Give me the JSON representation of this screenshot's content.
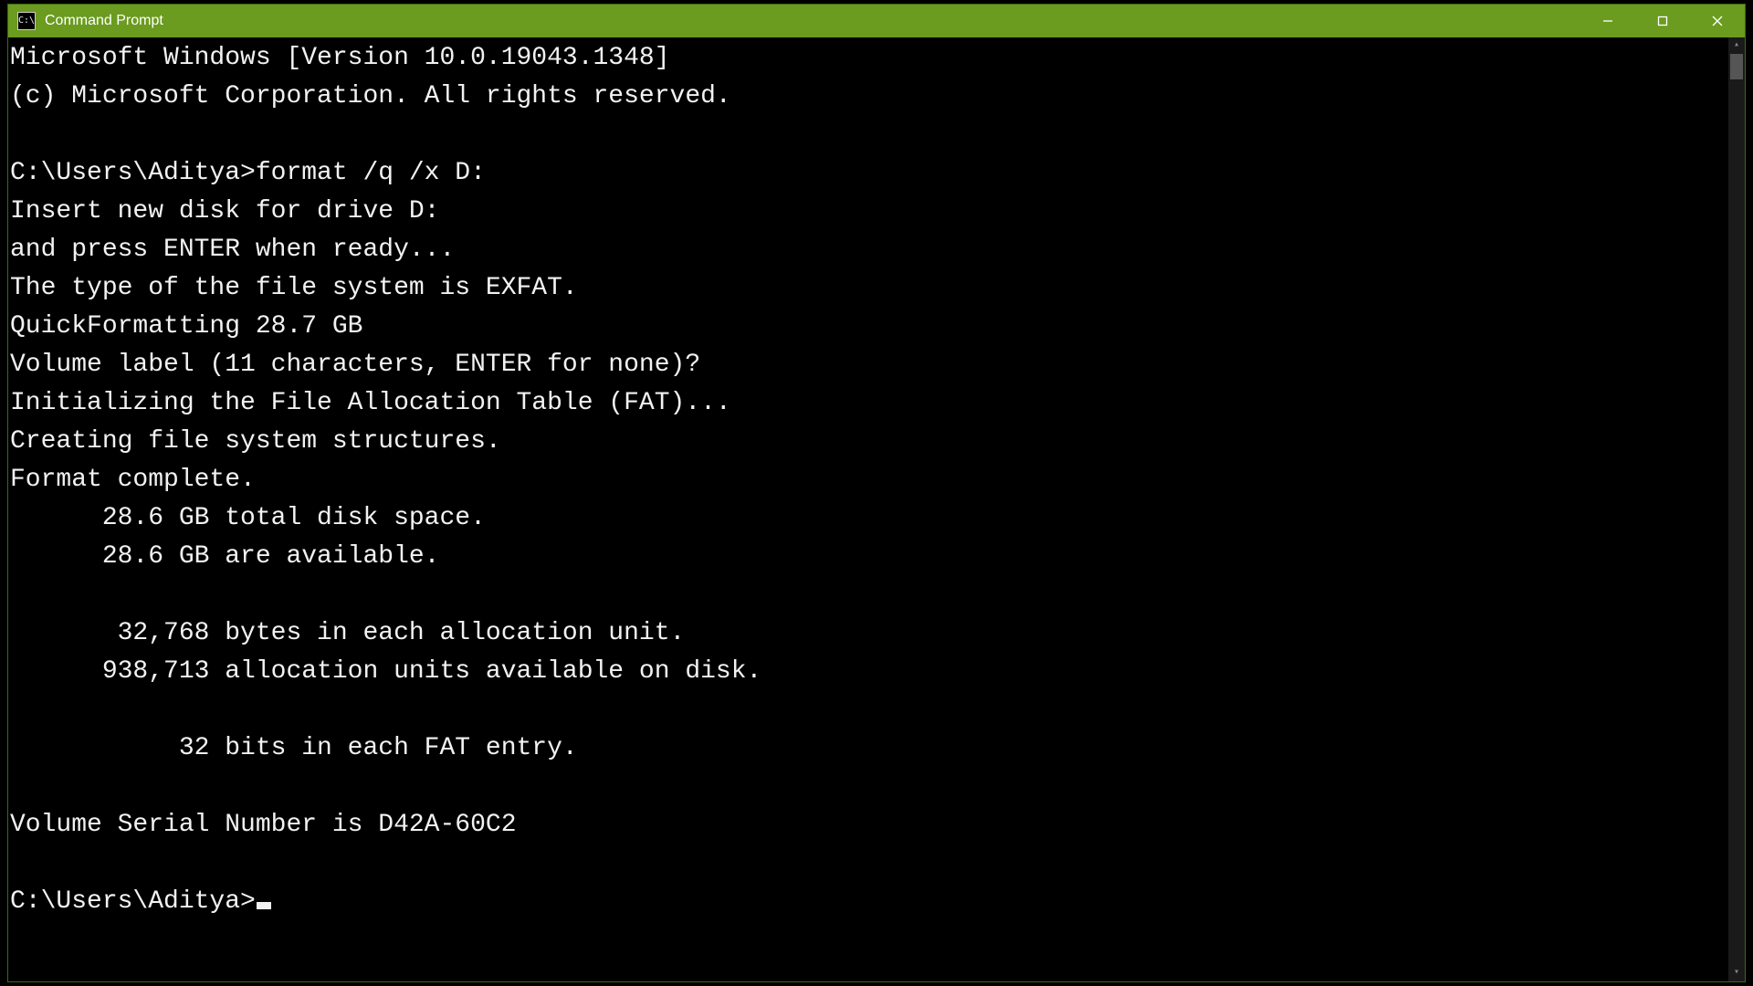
{
  "window": {
    "title": "Command Prompt"
  },
  "terminal": {
    "lines": [
      "Microsoft Windows [Version 10.0.19043.1348]",
      "(c) Microsoft Corporation. All rights reserved.",
      "",
      "C:\\Users\\Aditya>format /q /x D:",
      "Insert new disk for drive D:",
      "and press ENTER when ready...",
      "The type of the file system is EXFAT.",
      "QuickFormatting 28.7 GB",
      "Volume label (11 characters, ENTER for none)?",
      "Initializing the File Allocation Table (FAT)...",
      "Creating file system structures.",
      "Format complete.",
      "      28.6 GB total disk space.",
      "      28.6 GB are available.",
      "",
      "       32,768 bytes in each allocation unit.",
      "      938,713 allocation units available on disk.",
      "",
      "           32 bits in each FAT entry.",
      "",
      "Volume Serial Number is D42A-60C2",
      ""
    ],
    "prompt": "C:\\Users\\Aditya>"
  }
}
